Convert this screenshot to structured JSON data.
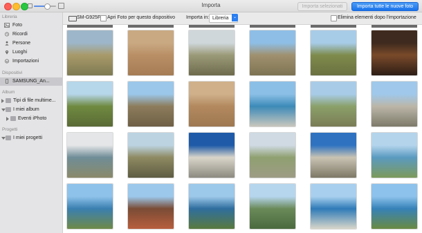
{
  "window": {
    "title": "Importa",
    "zoom_level": 0.6
  },
  "toolbar": {
    "import_selected_label": "Importa selezionati",
    "import_all_label": "Importa tutte le nuove foto"
  },
  "device_bar": {
    "device_name": "SM-G925F",
    "open_photos_label": "Apri Foto per questo dispositivo",
    "import_in_label": "Importa in:",
    "import_in_value": "Libreria",
    "delete_after_label": "Elimina elementi dopo l'importazione"
  },
  "sidebar": {
    "library_header": "Libreria",
    "library_items": [
      {
        "label": "Foto",
        "icon": "photos-icon"
      },
      {
        "label": "Ricordi",
        "icon": "memories-icon"
      },
      {
        "label": "Persone",
        "icon": "people-icon"
      },
      {
        "label": "Luoghi",
        "icon": "places-icon"
      },
      {
        "label": "Importazioni",
        "icon": "imports-icon"
      }
    ],
    "devices_header": "Dispositivi",
    "device_item": {
      "label": "SAMSUNG_An...",
      "icon": "phone-icon"
    },
    "albums_header": "Album",
    "album_items": [
      {
        "label": "Tipi di file multime...",
        "icon": "folder-icon"
      },
      {
        "label": "I miei album",
        "icon": "folder-icon"
      },
      {
        "label": "Eventi iPhoto",
        "icon": "folder-icon"
      }
    ],
    "projects_header": "Progetti",
    "project_items": [
      {
        "label": "I miei progetti",
        "icon": "folder-icon"
      }
    ]
  },
  "colors": {
    "accent": "#1a72ea",
    "sidebar_bg": "#e4e4e6",
    "grid_bg": "#ffffff"
  },
  "photos": [
    {
      "subject": "grassland with antelope",
      "top": "#9db6c9",
      "mid": "#a89a6a",
      "bottom": "#7e7a52"
    },
    {
      "subject": "rhinoceros resting",
      "top": "#c9a982",
      "mid": "#b98f66",
      "bottom": "#a57c55"
    },
    {
      "subject": "zebra in bushland",
      "top": "#cfd7db",
      "mid": "#9b9a78",
      "bottom": "#6d6b4c"
    },
    {
      "subject": "elephant",
      "top": "#8ebee6",
      "mid": "#a09170",
      "bottom": "#7d7352"
    },
    {
      "subject": "giraffes",
      "top": "#a7cce8",
      "mid": "#7e8b4c",
      "bottom": "#6b7040"
    },
    {
      "subject": "cat on dark floor",
      "top": "#3e2a1e",
      "mid": "#7a4a2a",
      "bottom": "#2c1d15"
    },
    {
      "subject": "giraffes in savannah",
      "top": "#b6d6ea",
      "mid": "#6f8a40",
      "bottom": "#5a6a36"
    },
    {
      "subject": "elephant walking",
      "top": "#9bc7ea",
      "mid": "#8d7c5c",
      "bottom": "#6e6046"
    },
    {
      "subject": "rhinoceros lying",
      "top": "#cfb08a",
      "mid": "#b3895f",
      "bottom": "#9e7851"
    },
    {
      "subject": "coastline",
      "top": "#8bbfe6",
      "mid": "#3c8ab8",
      "bottom": "#c9c7bd"
    },
    {
      "subject": "ostrich on hill",
      "top": "#a8cce8",
      "mid": "#8ba06a",
      "bottom": "#7a7c55"
    },
    {
      "subject": "penguins on rocks",
      "top": "#9fc8ea",
      "mid": "#bbb6a8",
      "bottom": "#7e7a6a"
    },
    {
      "subject": "lagoon",
      "top": "#e4e6e8",
      "mid": "#6f8d97",
      "bottom": "#8b8a6a"
    },
    {
      "subject": "zebras",
      "top": "#bcd4e2",
      "mid": "#8e8a62",
      "bottom": "#5e5c42"
    },
    {
      "subject": "penguins on beach",
      "top": "#1e5aa8",
      "mid": "#d9d5c9",
      "bottom": "#8c8a80"
    },
    {
      "subject": "rocky coast",
      "top": "#cfdae3",
      "mid": "#8fa070",
      "bottom": "#9d9c85"
    },
    {
      "subject": "penguin colony",
      "top": "#2e72c0",
      "mid": "#c9c3b3",
      "bottom": "#7d7866"
    },
    {
      "subject": "bay with beach",
      "top": "#b4d4ec",
      "mid": "#5a9ac0",
      "bottom": "#7d9a5a"
    },
    {
      "subject": "cliff and ocean",
      "top": "#8ec2ea",
      "mid": "#3a7fb0",
      "bottom": "#6f8a48"
    },
    {
      "subject": "cape signboard",
      "top": "#9cc8ec",
      "mid": "#7a4c36",
      "bottom": "#b85e3e"
    },
    {
      "subject": "cape point",
      "top": "#9cc8ea",
      "mid": "#2f6e9e",
      "bottom": "#5a7a3e"
    },
    {
      "subject": "mountain peak",
      "top": "#b6d6ee",
      "mid": "#6b8a5a",
      "bottom": "#4a6a3e"
    },
    {
      "subject": "ocean coastline",
      "top": "#a8d0ee",
      "mid": "#2e7bb8",
      "bottom": "#d8d6c9"
    },
    {
      "subject": "seaside cliffs",
      "top": "#8cc2ec",
      "mid": "#3682b8",
      "bottom": "#6a8a42"
    }
  ]
}
